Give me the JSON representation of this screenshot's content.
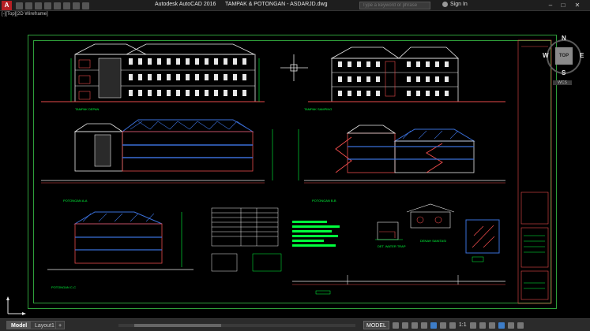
{
  "window": {
    "app_name": "Autodesk AutoCAD 2016",
    "file_name": "TAMPAK & POTONGAN - ASDARJD.dwg",
    "search_placeholder": "Type a keyword or phrase",
    "sign_in": "Sign In"
  },
  "viewport": {
    "label": "[-][Top][2D Wireframe]"
  },
  "viewcube": {
    "face": "TOP",
    "north": "N",
    "south": "S",
    "east": "E",
    "west": "W",
    "wcs": "WCS"
  },
  "drawing": {
    "labels": {
      "front": "TAMPAK DEPAN",
      "back": "TAMPAK SAMPING",
      "section_aa": "POTONGAN A-A",
      "section_bb": "POTONGAN B-B",
      "section_cc": "POTONGAN C-C",
      "water_trap": "DET. WATER TRAP",
      "canopy": "DENAH SANITASI"
    }
  },
  "layout_tabs": [
    {
      "label": "Model",
      "active": true
    },
    {
      "label": "Layout1",
      "active": false
    }
  ],
  "add_tab": "+",
  "statusbar": {
    "model": "MODEL",
    "scale": "1:1"
  },
  "colors": {
    "frame": "#2e9e3a",
    "roof": "#3a6fd8",
    "building": "#e8e8e8",
    "accent": "#ff2a2a",
    "text": "#00ff3c"
  }
}
